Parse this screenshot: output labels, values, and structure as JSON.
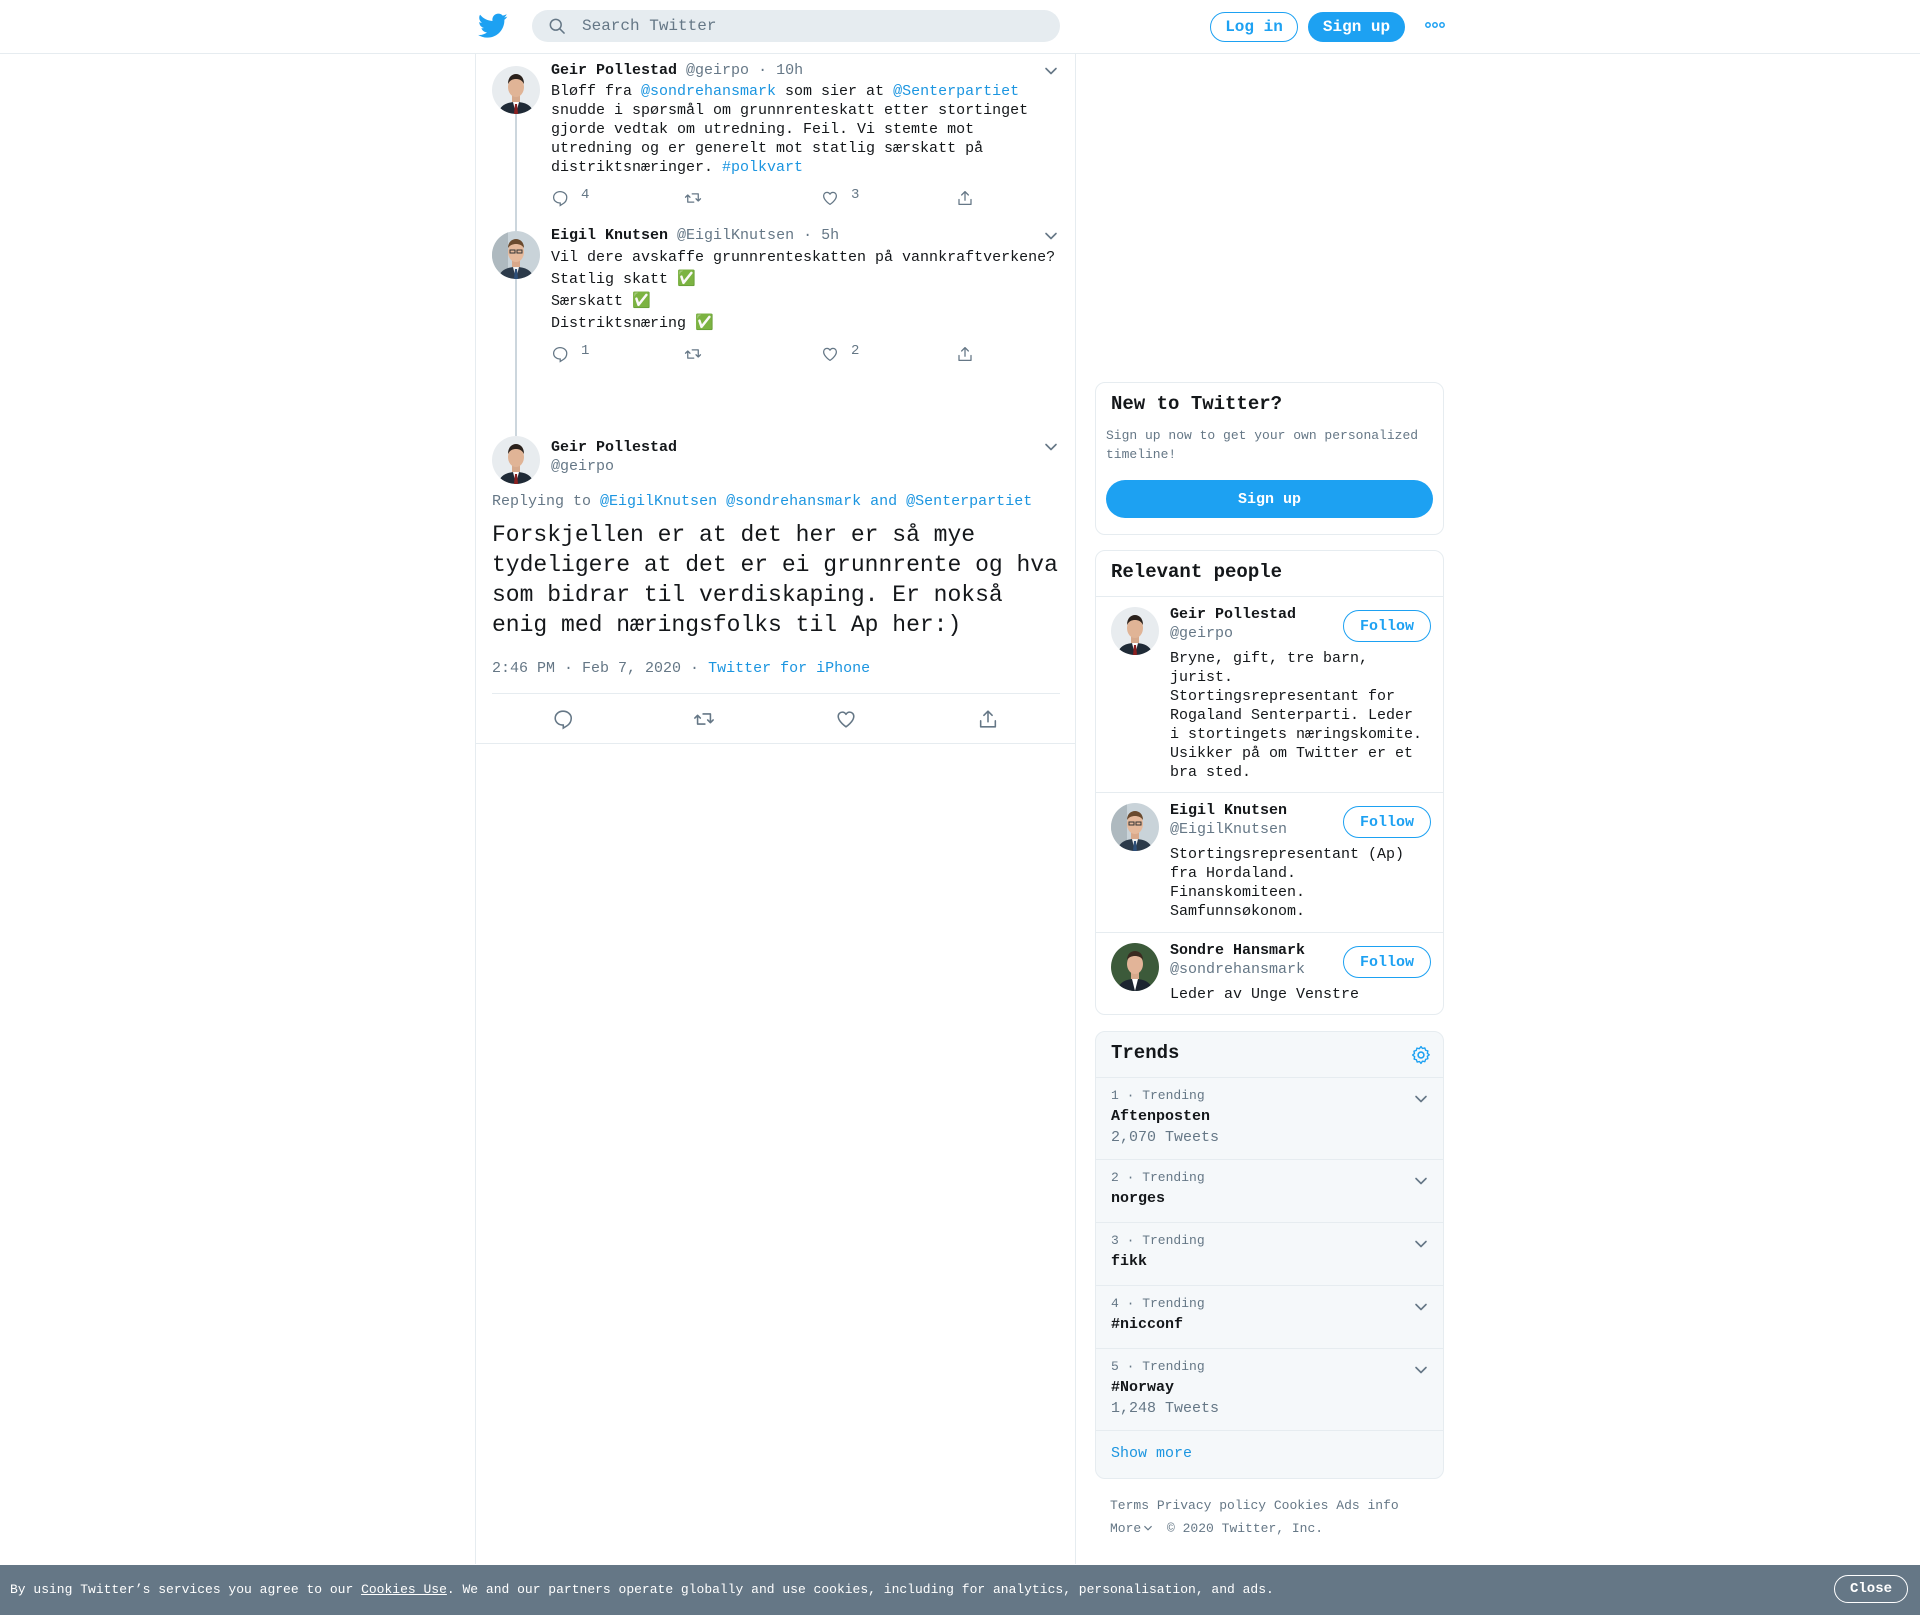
{
  "header": {
    "search_placeholder": "Search Twitter",
    "login_label": "Log in",
    "signup_label": "Sign up"
  },
  "thread": [
    {
      "name": "Geir Pollestad",
      "handle": "@geirpo",
      "time": "10h",
      "lines": [
        [
          {
            "t": "Bløff fra "
          },
          {
            "t": "@sondrehansmark",
            "link": true
          },
          {
            "t": " som sier at "
          },
          {
            "t": "@Senterpartiet",
            "link": true
          }
        ],
        [
          {
            "t": "snudde i spørsmål om grunnrenteskatt etter stortinget"
          }
        ],
        [
          {
            "t": "gjorde vedtak om utredning. Feil. Vi stemte mot"
          }
        ],
        [
          {
            "t": "utredning og er generelt mot statlig særskatt på"
          }
        ],
        [
          {
            "t": "distriktsnæringer. "
          },
          {
            "t": "#polkvart",
            "link": true
          }
        ]
      ],
      "replies": "4",
      "likes": "3"
    },
    {
      "name": "Eigil Knutsen",
      "handle": "@EigilKnutsen",
      "time": "5h",
      "lines": [
        [
          {
            "t": "Vil dere avskaffe grunnrenteskatten på vannkraftverkene?"
          }
        ],
        [
          {
            "t": "Statlig skatt ✅"
          }
        ],
        [
          {
            "t": "Særskatt ✅"
          }
        ],
        [
          {
            "t": "Distriktsnæring ✅"
          }
        ]
      ],
      "replies": "1",
      "likes": "2"
    }
  ],
  "focus": {
    "name": "Geir Pollestad",
    "handle": "@geirpo",
    "replying_prefix": "Replying to",
    "replying_to": [
      "@EigilKnutsen",
      "@sondrehansmark"
    ],
    "replying_and": "and",
    "replying_last": "@Senterpartiet",
    "text_lines": [
      "Forskjellen er at det her er så mye",
      "tydeligere at det er ei grunnrente og hva",
      "som bidrar til verdiskaping. Er nokså",
      "enig med næringsfolks til Ap her:)"
    ],
    "timestamp": "2:46 PM · Feb 7, 2020 ·",
    "source": "Twitter for iPhone"
  },
  "new_to_twitter": {
    "title": "New to Twitter?",
    "text_lines": [
      "Sign up now to get your own personalized",
      "timeline!"
    ],
    "button": "Sign up"
  },
  "relevant_people": {
    "title": "Relevant people",
    "follow_label": "Follow",
    "people": [
      {
        "name": "Geir Pollestad",
        "handle": "@geirpo",
        "bio_lines": [
          "Bryne, gift, tre barn,",
          "jurist.",
          "Stortingsrepresentant for",
          "Rogaland Senterparti. Leder",
          "i stortingets næringskomite.",
          "Usikker på om Twitter er et",
          "bra sted."
        ]
      },
      {
        "name": "Eigil Knutsen",
        "handle": "@EigilKnutsen",
        "bio_lines": [
          "Stortingsrepresentant (Ap)",
          "fra Hordaland.",
          "Finanskomiteen.",
          "Samfunnsøkonom."
        ]
      },
      {
        "name": "Sondre Hansmark",
        "handle": "@sondrehansmark",
        "bio_lines": [
          "Leder av Unge Venstre"
        ]
      }
    ]
  },
  "trends": {
    "title": "Trends",
    "items": [
      {
        "meta": "1 · Trending",
        "name": "Aftenposten",
        "count": "2,070 Tweets"
      },
      {
        "meta": "2 · Trending",
        "name": "norges",
        "count": ""
      },
      {
        "meta": "3 · Trending",
        "name": "fikk",
        "count": ""
      },
      {
        "meta": "4 · Trending",
        "name": "#nicconf",
        "count": ""
      },
      {
        "meta": "5 · Trending",
        "name": "#Norway",
        "count": "1,248 Tweets"
      }
    ],
    "show_more": "Show more"
  },
  "footer": {
    "links": [
      "Terms",
      "Privacy policy",
      "Cookies",
      "Ads info"
    ],
    "more": "More",
    "copyright": "© 2020 Twitter, Inc."
  },
  "cookie_bar": {
    "prefix": "By using Twitter’s services you agree to our ",
    "link": "Cookies Use",
    "suffix": ". We and our partners operate globally and use cookies, including for analytics, personalisation, and ads.",
    "close": "Close"
  },
  "colors": {
    "accent": "#1da1f2",
    "link": "#1b95e0",
    "secondary_text": "#657786",
    "cookie_bg": "#657786",
    "trends_bg": "#f5f8fa"
  }
}
